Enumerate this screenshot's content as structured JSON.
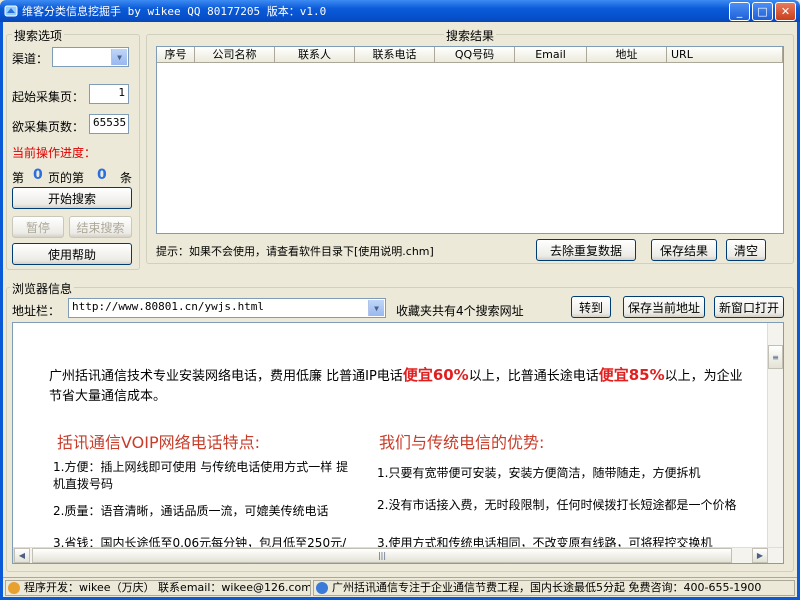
{
  "window": {
    "title": "维客分类信息挖掘手 by wikee QQ 80177205 版本：v1.0",
    "minimize": "_",
    "maximize": "□",
    "close": "✕"
  },
  "search_options": {
    "legend": "搜索选项",
    "channel_label": "渠道：",
    "channel_value": "",
    "start_page_label": "起始采集页：",
    "start_page_value": "1",
    "page_count_label": "欲采集页数：",
    "page_count_value": "65535",
    "progress_label": "当前操作进度：",
    "progress_prefix": "第",
    "progress_page": "0",
    "progress_mid": "页的第",
    "progress_item": "0",
    "progress_suffix": "条",
    "start_button": "开始搜索",
    "pause_button": "暂停",
    "stop_button": "结束搜索",
    "help_button": "使用帮助"
  },
  "results": {
    "legend": "搜索结果",
    "columns": [
      "序号",
      "公司名称",
      "联系人",
      "联系电话",
      "QQ号码",
      "Email",
      "地址",
      "URL"
    ],
    "hint": "提示：如果不会使用，请查看软件目录下[使用说明.chm]",
    "dedupe_button": "去除重复数据",
    "save_button": "保存结果",
    "clear_button": "清空"
  },
  "browser": {
    "legend": "浏览器信息",
    "address_label": "地址栏：",
    "address_value": "http://www.80801.cn/ywjs.html",
    "favorites_text": "收藏夹共有4个搜索网址",
    "goto_button": "转到",
    "save_address_button": "保存当前地址",
    "new_window_button": "新窗口打开",
    "page": {
      "intro_1": "广州括讯通信技术专业安装网络电话，费用低廉 比普通IP电话",
      "intro_hl1": "便宜60%",
      "intro_2": "以上，比普通长途电话",
      "intro_hl2": "便宜85%",
      "intro_3": "以上，为企业节省大量通信成本。",
      "left_heading": "括讯通信VOIP网络电话特点:",
      "right_heading": "我们与传统电信的优势:",
      "left_items": [
        "1.方便：插上网线即可使用 与传统电话使用方式一样 提机直拨号码",
        "2.质量：语音清晰，通话品质一流，可媲美传统电话",
        "3.省钱：国内长途低至0.06元每分钟，包月低至250元/"
      ],
      "right_items": [
        "1.只要有宽带便可安装，安装方便简洁，随带随走，方便拆机",
        "2.没有市话接入费，无时段限制，任何时候拨打长短途都是一个价格",
        "3.使用方式和传统电话相同，不改变原有线路，可将程控交换机"
      ]
    }
  },
  "statusbar": {
    "developer": "程序开发：wikee（万庆） 联系email：wikee@126.com",
    "ad": "广州括讯通信专注于企业通信节费工程，国内长途最低5分起 免费咨询：400-655-1900"
  }
}
